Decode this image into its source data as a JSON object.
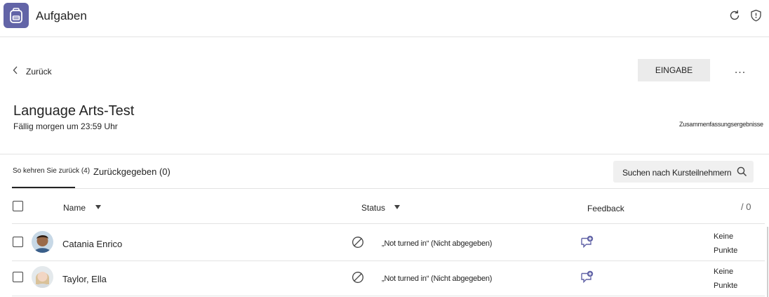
{
  "app": {
    "title": "Aufgaben",
    "accent": "#6264a7"
  },
  "nav": {
    "back_label": "Zurück"
  },
  "actions": {
    "primary_label": "EINGABE",
    "more_label": "..."
  },
  "assignment": {
    "title": "Language Arts-Test",
    "due": "Fällig morgen um 23:59 Uhr",
    "summary_link": "Zusammenfassungsergebnisse"
  },
  "tabs": [
    {
      "label": "So kehren Sie zurück (4)",
      "selected": true
    },
    {
      "label": "Zurückgegeben (0)",
      "selected": false
    }
  ],
  "search": {
    "placeholder": "Suchen nach Kursteilnehmern"
  },
  "table": {
    "columns": {
      "name": "Name",
      "status": "Status",
      "feedback": "Feedback",
      "points": "/ 0"
    },
    "rows": [
      {
        "name": "Catania Enrico",
        "status": "„Not turned in“ (Nicht abgegeben)",
        "points": [
          "Keine",
          "Punkte"
        ]
      },
      {
        "name": "Taylor, Ella",
        "status": "„Not turned in“ (Nicht abgegeben)",
        "points": [
          "Keine",
          "Punkte"
        ]
      }
    ]
  }
}
